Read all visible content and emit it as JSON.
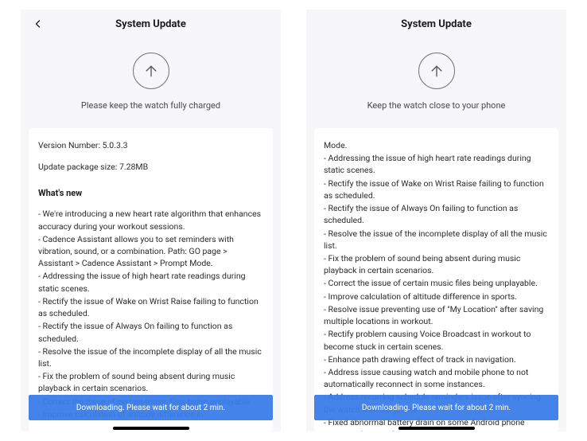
{
  "left": {
    "header_title": "System Update",
    "subtitle": "Please keep the watch fully charged",
    "version_label": "Version Number: 5.0.3.3",
    "pkg_label": "Update package size: 7.28MB",
    "whats_new_title": "What's new",
    "items": [
      "- We're introducing a new heart rate algorithm that enhances accuracy during your workout sessions.",
      "- Cadence Assistant allows you to set reminders with vibration, sound, or a combination.  Path: GO page > Assistant > Cadence Assistant > Prompt Mode.",
      "- Addressing the issue of high heart rate readings during static scenes.",
      "- Rectify the issue of Wake on Wrist Raise failing to function as scheduled.",
      "- Rectify the issue of Always On failing to function as scheduled.",
      "- Resolve the issue of the incomplete display of all the music list.",
      "- Fix the problem of sound being absent during music playback in certain scenarios.",
      "- Correct the issue of certain music files being unplayable.",
      "- Improve calculation of altitude difference in"
    ],
    "download_text": "Downloading. Please wait for about 2 min."
  },
  "right": {
    "header_title": "System Update",
    "subtitle": "Keep the watch close to your phone",
    "items": [
      "Mode.",
      "- Addressing the issue of high heart rate readings during static scenes.",
      "- Rectify the issue of Wake on Wrist Raise failing to function as scheduled.",
      "- Rectify the issue of Always On failing to function as scheduled.",
      "- Resolve the issue of the incomplete display of all the music list.",
      "- Fix the problem of sound being absent during music playback in certain scenarios.",
      "- Correct the issue of certain music files being unplayable.",
      "- Improve calculation of altitude difference in sports.",
      "- Resolve issue preventing use of \"My Location\" after saving multiple locations in workout.",
      "- Rectify problem causing Voice Broadcast in workout to become stuck in certain scenes.",
      "- Enhance path drawing effect of track in navigation.",
      "- Address issue causing watch and mobile phone to not automatically reconnect in some instances.",
      "- Address recurring schedule reminders issue after syncing the watch with the phone.",
      "- Fixed abnormal battery drain on some Android phone connected to watch."
    ],
    "download_text": "Downloading. Please wait for about 2 min."
  }
}
